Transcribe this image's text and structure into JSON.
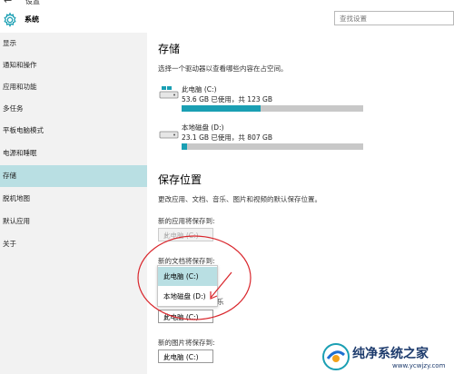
{
  "window": {
    "back_glyph": "←",
    "title": "设置"
  },
  "header": {
    "app_name": "系统",
    "search_placeholder": "查找设置"
  },
  "sidebar": {
    "items": [
      {
        "label": "显示"
      },
      {
        "label": "通知和操作"
      },
      {
        "label": "应用和功能"
      },
      {
        "label": "多任务"
      },
      {
        "label": "平板电脑模式"
      },
      {
        "label": "电源和睡眠"
      },
      {
        "label": "存储"
      },
      {
        "label": "脱机地图"
      },
      {
        "label": "默认应用"
      },
      {
        "label": "关于"
      }
    ],
    "active_index": 6
  },
  "storage": {
    "heading": "存储",
    "description": "选择一个驱动器以查看哪些内容在占空间。",
    "drives": [
      {
        "name": "此电脑 (C:)",
        "usage": "53.6 GB 已使用，共 123 GB",
        "fraction_used": 0.436,
        "icon": "pc-drive-icon"
      },
      {
        "name": "本地磁盘 (D:)",
        "usage": "23.1 GB 已使用，共 807 GB",
        "fraction_used": 0.029,
        "icon": "disk-drive-icon"
      }
    ]
  },
  "save_locations": {
    "heading": "保存位置",
    "description": "更改应用、文档、音乐、图片和视频的默认保存位置。",
    "new_apps_label": "新的应用将保存到:",
    "new_apps_value": "此电脑 (C:)",
    "new_docs_label": "新的文档将保存到:",
    "music_label_fragment": "乐",
    "music_value": "此电脑 (C:)",
    "new_pictures_label": "新的图片将保存到:",
    "pictures_value": "此电脑 (C:)",
    "dropdown_options": [
      "此电脑 (C:)",
      "本地磁盘 (D:)"
    ],
    "selected_option": "此电脑 (C:)"
  },
  "colors": {
    "accent": "#1a9fb3",
    "selection": "#b9dfe3",
    "annotation": "#d9262c",
    "sidebar_bg": "#f2f2f2"
  },
  "watermark": {
    "text": "纯净系统之家",
    "url": "www.ycwjzy.com"
  }
}
